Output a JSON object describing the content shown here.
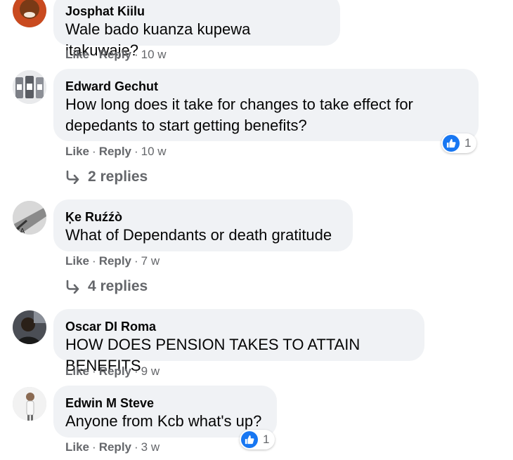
{
  "comments": [
    {
      "author": "Josphat Kiilu",
      "text": "Wale bado kuanza kupewa itakuwaje?",
      "like": "Like",
      "reply": "Reply",
      "time": "10 w"
    },
    {
      "author": "Edward Gechut",
      "text_lines": [
        "How long does it take for changes to take effect for",
        "depedants to start getting benefits?"
      ],
      "like": "Like",
      "reply": "Reply",
      "time": "10 w",
      "reaction_count": "1",
      "replies": "2 replies"
    },
    {
      "author": "Ķe Ruźźò",
      "text": "What of Dependants or death gratitude",
      "like": "Like",
      "reply": "Reply",
      "time": "7 w",
      "replies": "4 replies"
    },
    {
      "author": "Oscar DI Roma",
      "text": "HOW DOES PENSION TAKES TO ATTAIN BENEFITS",
      "like": "Like",
      "reply": "Reply",
      "time": "9 w"
    },
    {
      "author": "Edwin M Steve",
      "text": "Anyone from Kcb what's up?",
      "like": "Like",
      "reply": "Reply",
      "time": "3 w",
      "reaction_count": "1"
    }
  ],
  "colors": {
    "bubble": "#f0f2f5",
    "secondary_text": "#65676b",
    "like_blue": "#1877f2"
  },
  "icons": {
    "reply_arrow": "reply-arrow-icon",
    "like": "thumbs-up-icon"
  },
  "separator": "·"
}
